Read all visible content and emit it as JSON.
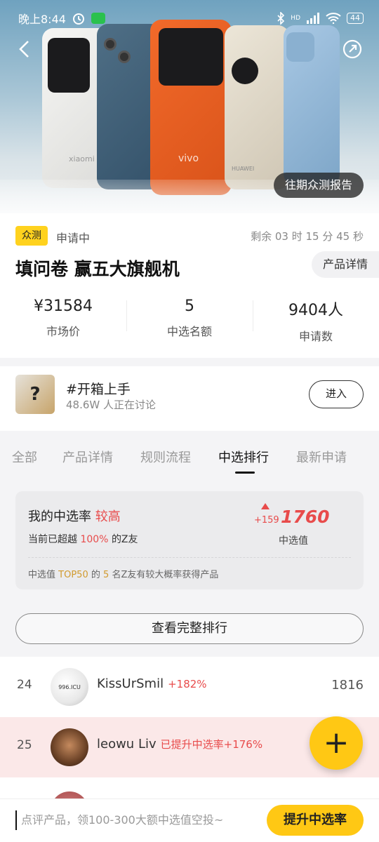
{
  "status_bar": {
    "time": "晚上8:44",
    "battery": "44",
    "network": "HD"
  },
  "hero": {
    "report_label": "往期众测报告",
    "brand_vivo": "vivo",
    "brand_xiaomi": "xiaomi",
    "brand_huawei": "HUAWEI"
  },
  "info": {
    "badge": "众测",
    "apply_status": "申请中",
    "countdown": "剩余 03 时 15 分 45 秒",
    "title": "填问卷 赢五大旗舰机",
    "detail_label": "产品详情",
    "stats": [
      {
        "value": "¥31584",
        "label": "市场价"
      },
      {
        "value": "5",
        "label": "中选名额"
      },
      {
        "value": "9404人",
        "label": "申请数"
      }
    ]
  },
  "topic": {
    "title": "#开箱上手",
    "subtitle": "48.6W 人正在讨论",
    "enter_label": "进入",
    "thumb_glyph": "?"
  },
  "tabs": [
    "全部",
    "产品详情",
    "规则流程",
    "中选排行",
    "最新申请"
  ],
  "active_tab": "中选排行",
  "rate_card": {
    "title_prefix": "我的中选率",
    "level": "较高",
    "desc_prefix": "当前已超越",
    "desc_percent": "100%",
    "desc_suffix": "的Z友",
    "delta": "+159",
    "value": "1760",
    "value_label": "中选值",
    "foot_prefix": "中选值",
    "foot_top": "TOP50",
    "foot_mid": "的",
    "foot_count": "5",
    "foot_suffix": "名Z友有较大概率获得产品"
  },
  "full_rank_label": "查看完整排行",
  "ranks": [
    {
      "rank": "24",
      "name": "KissUrSmil",
      "increase": "+182%",
      "score": "1816",
      "avatar_text": "996.ICU"
    },
    {
      "rank": "25",
      "name": "leowu Liv",
      "increase": "已提升中选率+176%",
      "score": ""
    }
  ],
  "fab_label": "+",
  "bottom": {
    "placeholder": "点评产品，领100-300大额中选值空投~",
    "boost_label": "提升中选率"
  },
  "colors": {
    "accent": "#ffc814",
    "highlight": "#e84b4b",
    "badge": "#ffd21e"
  }
}
